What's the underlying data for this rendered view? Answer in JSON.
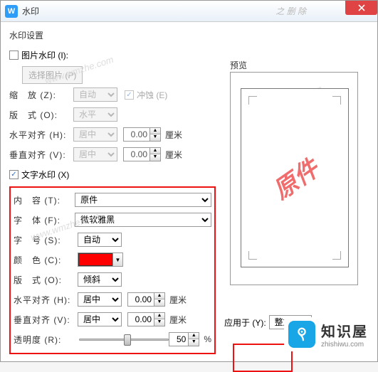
{
  "window": {
    "title": "水印",
    "ghost_text": "之 删 除",
    "close": "×"
  },
  "section_title": "水印设置",
  "image_wm": {
    "checkbox_label": "图片水印 (I):",
    "select_btn": "选择图片 (P)",
    "scale_label": "缩　放 (Z):",
    "scale_value": "自动",
    "washout_label": "冲蚀 (E)",
    "layout_label": "版　式 (O):",
    "layout_value": "水平",
    "halign_label": "水平对齐 (H):",
    "halign_value": "居中",
    "halign_num": "0.00",
    "valign_label": "垂直对齐 (V):",
    "valign_value": "居中",
    "valign_num": "0.00",
    "unit": "厘米"
  },
  "text_wm": {
    "checkbox_label": "文字水印 (X)",
    "content_label": "内　容 (T):",
    "content_value": "原件",
    "font_label": "字　体 (F):",
    "font_value": "微软雅黑",
    "size_label": "字　号 (S):",
    "size_value": "自动",
    "color_label": "颜　色 (C):",
    "color_value": "#ff0000",
    "layout_label": "版　式 (O):",
    "layout_value": "倾斜",
    "halign_label": "水平对齐 (H):",
    "halign_value": "居中",
    "halign_num": "0.00",
    "valign_label": "垂直对齐 (V):",
    "valign_value": "居中",
    "valign_num": "0.00",
    "opacity_label": "透明度 (R):",
    "opacity_value": "50",
    "opacity_unit": "%",
    "unit": "厘米"
  },
  "preview": {
    "label": "预览",
    "watermark_text": "原件"
  },
  "apply": {
    "label": "应用于 (Y):",
    "value": "整篇文"
  },
  "brand": {
    "cn": "知识屋",
    "en": "zhishiwu.com"
  },
  "ghost_wm": "www.wmzhe.com"
}
